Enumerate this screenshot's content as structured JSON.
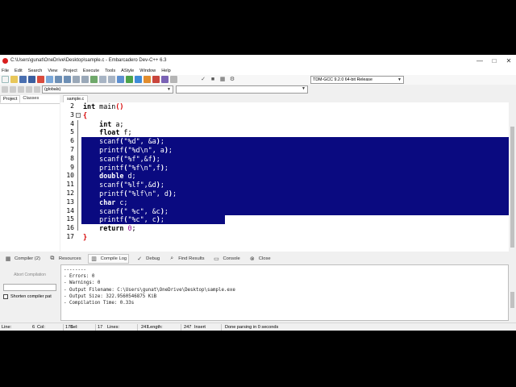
{
  "window": {
    "title": "C:\\Users\\gunat\\OneDrive\\Desktop\\sample.c - Embarcadero Dev-C++ 6.3",
    "minimize": "—",
    "maximize": "□",
    "close": "✕"
  },
  "menu": [
    "File",
    "Edit",
    "Search",
    "View",
    "Project",
    "Execute",
    "Tools",
    "AStyle",
    "Window",
    "Help"
  ],
  "toolbar": {
    "compiler": "TDM-GCC 9.2.0 64-bit Release",
    "scope": "(globals)"
  },
  "left_panel": {
    "tabs": [
      "Project",
      "Classes"
    ]
  },
  "editor": {
    "file_tab": "sample.c",
    "lines": [
      {
        "num": "2",
        "code": "int main()"
      },
      {
        "num": "3",
        "code": "{"
      },
      {
        "num": "4",
        "code": "    int a;"
      },
      {
        "num": "5",
        "code": "    float f;"
      },
      {
        "num": "6",
        "code": "    scanf(\"%d\", &a);"
      },
      {
        "num": "7",
        "code": "    printf(\"%d\\n\", a);"
      },
      {
        "num": "8",
        "code": "    scanf(\"%f\",&f);"
      },
      {
        "num": "9",
        "code": "    printf(\"%f\\n\",f);"
      },
      {
        "num": "10",
        "code": "    double d;"
      },
      {
        "num": "11",
        "code": "    scanf(\"%lf\",&d);"
      },
      {
        "num": "12",
        "code": "    printf(\"%lf\\n\", d);"
      },
      {
        "num": "13",
        "code": "    char c;"
      },
      {
        "num": "14",
        "code": "    scanf(\" %c\", &c);"
      },
      {
        "num": "15",
        "code": "    printf(\"%c\", c);"
      },
      {
        "num": "16",
        "code": "    return 0;"
      },
      {
        "num": "17",
        "code": "}"
      }
    ]
  },
  "bottom_tabs": [
    {
      "label": "Compiler (2)",
      "icon": "grid-icon"
    },
    {
      "label": "Resources",
      "icon": "resources-icon"
    },
    {
      "label": "Compile Log",
      "icon": "chart-icon"
    },
    {
      "label": "Debug",
      "icon": "check-icon"
    },
    {
      "label": "Find Results",
      "icon": "find-icon"
    },
    {
      "label": "Console",
      "icon": "console-icon"
    },
    {
      "label": "Close",
      "icon": "close-icon"
    }
  ],
  "bottom_panel": {
    "abort_label": "Abort Compilation",
    "shorten_label": "Shorten compiler pat"
  },
  "compile_log": [
    "--------",
    "- Errors: 0",
    "- Warnings: 0",
    "- Output Filename: C:\\Users\\gunat\\OneDrive\\Desktop\\sample.exe",
    "- Output Size: 322.9560546875 KiB",
    "- Compilation Time: 0.33s"
  ],
  "status": {
    "line_label": "Line:",
    "line_value": "6",
    "col_label": "Col:",
    "col_value": "1",
    "sel_label": "Sel:",
    "sel_value": "178",
    "lines_label": "Lines:",
    "lines_value": "17",
    "length_label": "Length:",
    "length_value": "247",
    "mode": "Insert",
    "message": "Done parsing in 0 seconds"
  }
}
